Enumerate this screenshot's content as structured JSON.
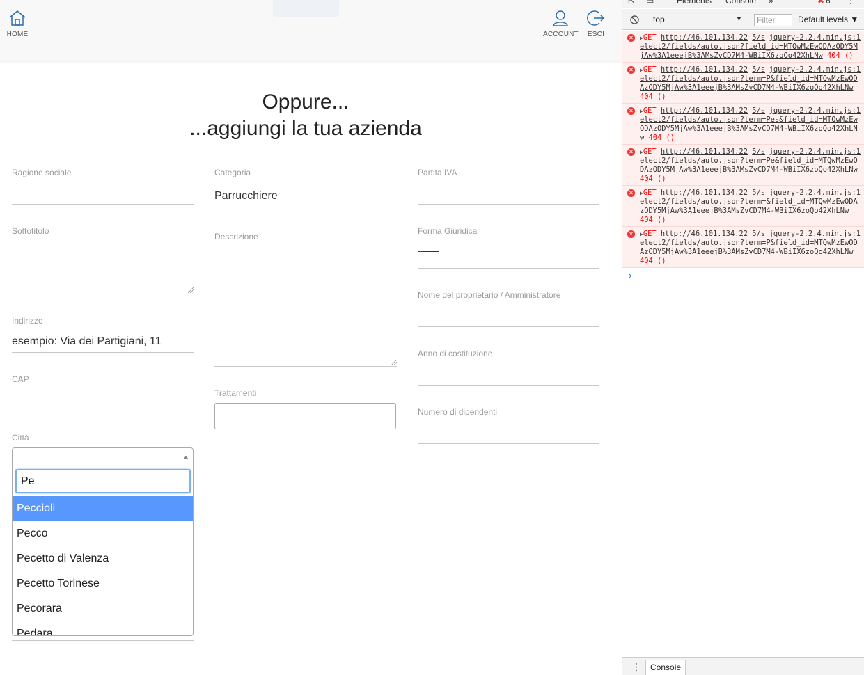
{
  "nav": {
    "home": "HOME",
    "account": "ACCOUNT",
    "esci": "ESCI"
  },
  "heading": {
    "line1": "Oppure...",
    "line2": "...aggiungi la tua azienda"
  },
  "form": {
    "ragione_sociale": {
      "label": "Ragione sociale",
      "value": ""
    },
    "categoria": {
      "label": "Categoria",
      "value": "Parrucchiere"
    },
    "partita_iva": {
      "label": "Partita IVA",
      "value": ""
    },
    "sottotitolo": {
      "label": "Sottotitolo",
      "value": ""
    },
    "descrizione": {
      "label": "Descrizione",
      "value": ""
    },
    "forma_giuridica": {
      "label": "Forma Giuridica",
      "value": "---------"
    },
    "nome_proprietario": {
      "label": "Nome del proprietario / Amministratore",
      "value": ""
    },
    "indirizzo": {
      "label": "Indirizzo",
      "value": "esempio: Via dei Partigiani, 11"
    },
    "anno_costituzione": {
      "label": "Anno di costituzione",
      "value": ""
    },
    "cap": {
      "label": "CAP",
      "value": ""
    },
    "trattamenti": {
      "label": "Trattamenti",
      "value": ""
    },
    "numero_dipendenti": {
      "label": "Numero di dipendenti",
      "value": ""
    },
    "citta": {
      "label": "Città",
      "selected": "",
      "search": "Pe",
      "options": [
        "Peccioli",
        "Pecco",
        "Pecetto di Valenza",
        "Pecetto Torinese",
        "Pecorara",
        "Pedara"
      ],
      "highlighted_index": 0
    }
  },
  "devtools": {
    "tabs": [
      "Elements",
      "Console",
      "»"
    ],
    "error_count": "6",
    "context": "top",
    "filter_placeholder": "Filter",
    "levels": "Default levels",
    "drawer_tab": "Console",
    "errors": [
      {
        "method": "GET",
        "url": "http://46.101.134.22",
        "source": "jquery-2.2.4.min.js:1",
        "path": "5/select2/fields/auto.json?field_id=MTQwMzEwODAzODY5MjAw%3A1eeejB%3AMsZvCD7M4-WBiIX6zoQo42XhLNw",
        "status": "404 ()"
      },
      {
        "method": "GET",
        "url": "http://46.101.134.22",
        "source": "jquery-2.2.4.min.js:1",
        "path": "5/select2/fields/auto.json?term=P&field_id=MTQwMzEwODAzODY5MjAw%3A1eeejB%3AMsZvCD7M4-WBiIX6zoQo42XhLNw",
        "status": "404 ()"
      },
      {
        "method": "GET",
        "url": "http://46.101.134.22",
        "source": "jquery-2.2.4.min.js:1",
        "path": "5/select2/fields/auto.json?term=Pes&field_id=MTQwMzEwODAzODY5MjAw%3A1eeejB%3AMsZvCD7M4-WBiIX6zoQo42XhLNw",
        "status": "404 ()"
      },
      {
        "method": "GET",
        "url": "http://46.101.134.22",
        "source": "jquery-2.2.4.min.js:1",
        "path": "5/select2/fields/auto.json?term=Pe&field_id=MTQwMzEwODAzODY5MjAw%3A1eeejB%3AMsZvCD7M4-WBiIX6zoQo42XhLNw",
        "status": "404 ()"
      },
      {
        "method": "GET",
        "url": "http://46.101.134.22",
        "source": "jquery-2.2.4.min.js:1",
        "path": "5/select2/fields/auto.json?term=&field_id=MTQwMzEwODAzODY5MjAw%3A1eeejB%3AMsZvCD7M4-WBiIX6zoQo42XhLNw",
        "status": "404 ()"
      },
      {
        "method": "GET",
        "url": "http://46.101.134.22",
        "source": "jquery-2.2.4.min.js:1",
        "path": "5/select2/fields/auto.json?term=P&field_id=MTQwMzEwODAzODY5MjAw%3A1eeejB%3AMsZvCD7M4-WBiIX6zoQo42XhLNw",
        "status": "404 ()"
      }
    ]
  }
}
